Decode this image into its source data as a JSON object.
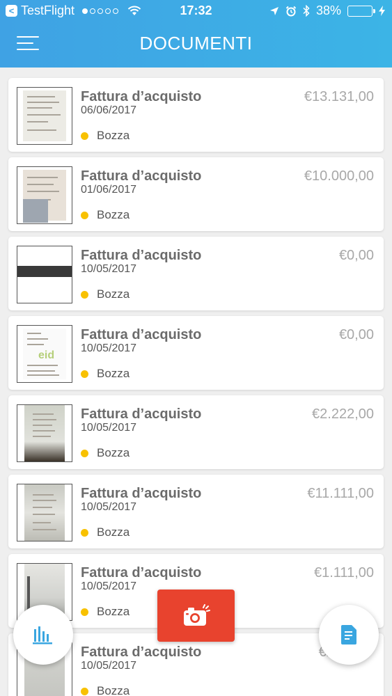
{
  "status_bar": {
    "back_app": "TestFlight",
    "back_glyph": "<",
    "time": "17:32",
    "battery": "38%",
    "battery_level": 0.38
  },
  "header": {
    "title": "DOCUMENTI"
  },
  "documents": [
    {
      "title": "Fattura d’acquisto",
      "date": "06/06/2017",
      "amount": "€13.131,00",
      "status": "Bozza"
    },
    {
      "title": "Fattura d’acquisto",
      "date": "01/06/2017",
      "amount": "€10.000,00",
      "status": "Bozza"
    },
    {
      "title": "Fattura d’acquisto",
      "date": "10/05/2017",
      "amount": "€0,00",
      "status": "Bozza"
    },
    {
      "title": "Fattura d’acquisto",
      "date": "10/05/2017",
      "amount": "€0,00",
      "status": "Bozza"
    },
    {
      "title": "Fattura d’acquisto",
      "date": "10/05/2017",
      "amount": "€2.222,00",
      "status": "Bozza"
    },
    {
      "title": "Fattura d’acquisto",
      "date": "10/05/2017",
      "amount": "€11.111,00",
      "status": "Bozza"
    },
    {
      "title": "Fattura d’acquisto",
      "date": "10/05/2017",
      "amount": "€1.111,00",
      "status": "Bozza"
    },
    {
      "title": "Fattura d’acquisto",
      "date": "10/05/2017",
      "amount": "€22",
      "status": "Bozza"
    }
  ],
  "colors": {
    "header_gradient_start": "#3fa2e4",
    "header_gradient_end": "#3cb4e6",
    "status_dot": "#f8c100",
    "camera_button": "#e8432e",
    "icon_blue": "#3aa6e0"
  },
  "icons": {
    "menu": "hamburger-icon",
    "stats": "bar-chart-icon",
    "camera": "camera-icon",
    "documents": "document-icon"
  }
}
